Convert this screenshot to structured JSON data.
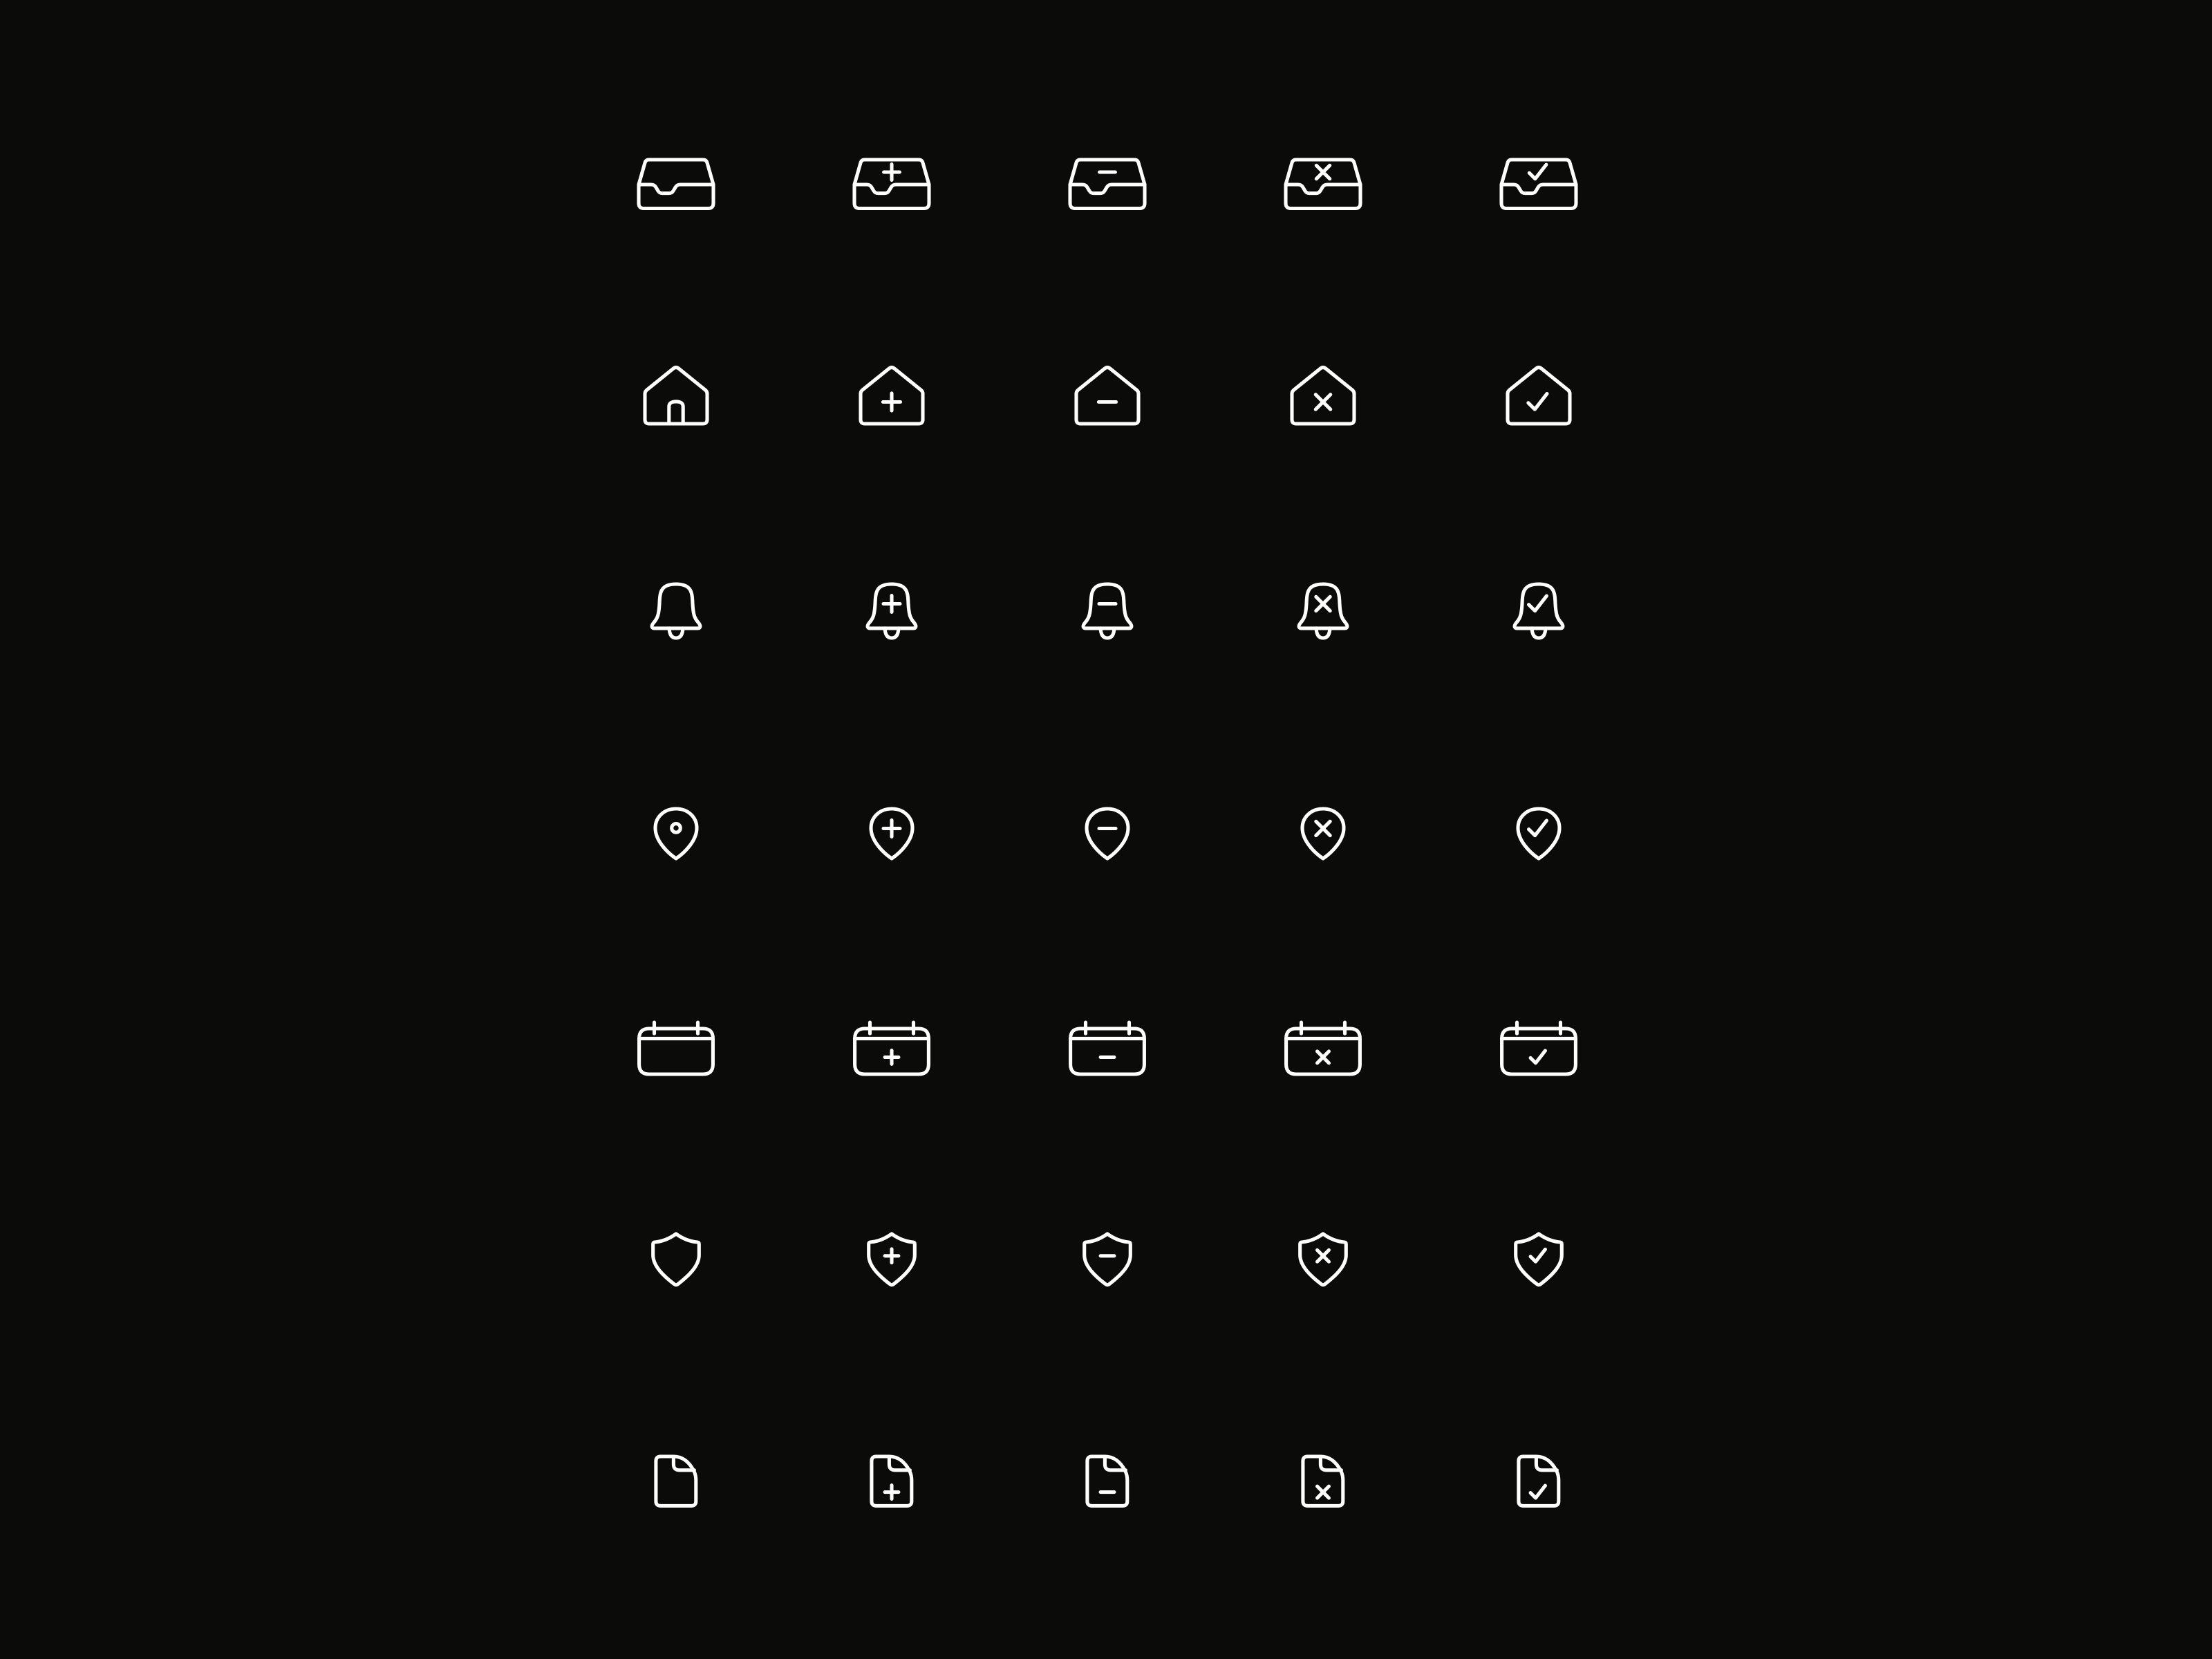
{
  "colors": {
    "background": "#0b0b09",
    "stroke": "#ffffff"
  },
  "rows": [
    {
      "name": "inbox",
      "icons": [
        "inbox-icon",
        "inbox-plus-icon",
        "inbox-minus-icon",
        "inbox-x-icon",
        "inbox-check-icon"
      ]
    },
    {
      "name": "home",
      "icons": [
        "home-icon",
        "home-plus-icon",
        "home-minus-icon",
        "home-x-icon",
        "home-check-icon"
      ]
    },
    {
      "name": "bell",
      "icons": [
        "bell-icon",
        "bell-plus-icon",
        "bell-minus-icon",
        "bell-x-icon",
        "bell-check-icon"
      ]
    },
    {
      "name": "location-pin",
      "icons": [
        "location-pin-icon",
        "location-pin-plus-icon",
        "location-pin-minus-icon",
        "location-pin-x-icon",
        "location-pin-check-icon"
      ]
    },
    {
      "name": "calendar",
      "icons": [
        "calendar-icon",
        "calendar-plus-icon",
        "calendar-minus-icon",
        "calendar-x-icon",
        "calendar-check-icon"
      ]
    },
    {
      "name": "shield",
      "icons": [
        "shield-icon",
        "shield-plus-icon",
        "shield-minus-icon",
        "shield-x-icon",
        "shield-check-icon"
      ]
    },
    {
      "name": "file",
      "icons": [
        "file-icon",
        "file-plus-icon",
        "file-minus-icon",
        "file-x-icon",
        "file-check-icon"
      ]
    }
  ]
}
